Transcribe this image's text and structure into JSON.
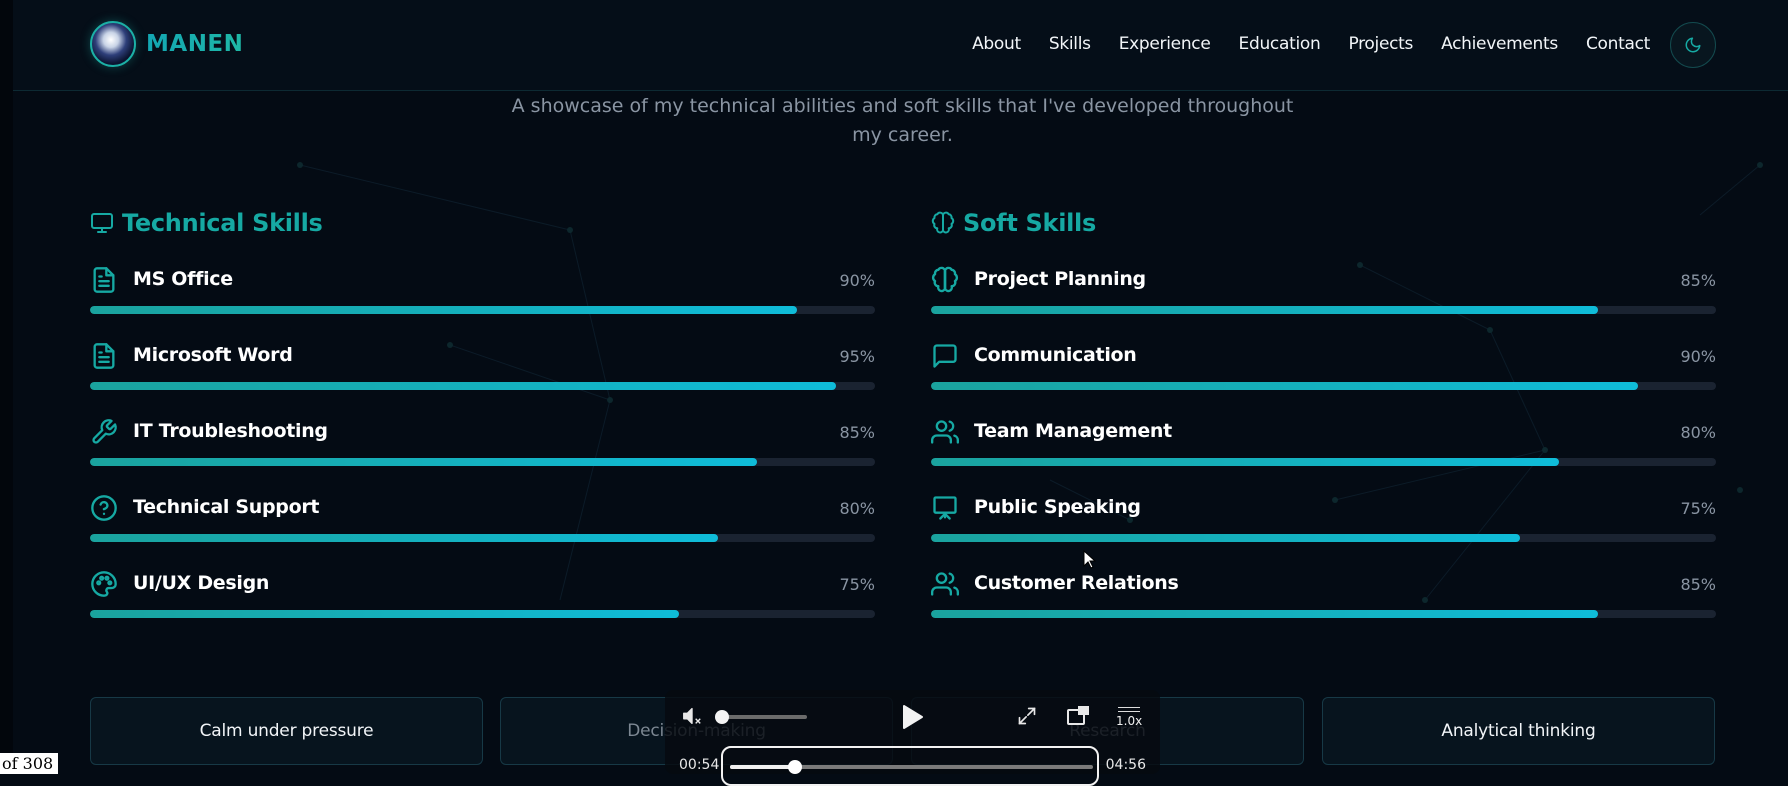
{
  "header": {
    "brand": "MANEN",
    "nav": [
      "About",
      "Skills",
      "Experience",
      "Education",
      "Projects",
      "Achievements",
      "Contact"
    ]
  },
  "intro": {
    "subtitle": "A showcase of my technical abilities and soft skills that I've developed throughout my career."
  },
  "technical": {
    "title": "Technical Skills",
    "icon": "monitor-icon",
    "skills": [
      {
        "name": "MS Office",
        "percent": 90,
        "icon": "file-text-icon"
      },
      {
        "name": "Microsoft Word",
        "percent": 95,
        "icon": "file-text-icon"
      },
      {
        "name": "IT Troubleshooting",
        "percent": 85,
        "icon": "wrench-icon"
      },
      {
        "name": "Technical Support",
        "percent": 80,
        "icon": "help-circle-icon"
      },
      {
        "name": "UI/UX Design",
        "percent": 75,
        "icon": "palette-icon"
      }
    ]
  },
  "soft": {
    "title": "Soft Skills",
    "icon": "brain-icon",
    "skills": [
      {
        "name": "Project Planning",
        "percent": 85,
        "icon": "brain-icon"
      },
      {
        "name": "Communication",
        "percent": 90,
        "icon": "message-square-icon"
      },
      {
        "name": "Team Management",
        "percent": 80,
        "icon": "users-icon"
      },
      {
        "name": "Public Speaking",
        "percent": 75,
        "icon": "presentation-icon"
      },
      {
        "name": "Customer Relations",
        "percent": 85,
        "icon": "users-icon"
      }
    ]
  },
  "tags": [
    "Calm under pressure",
    "Decision-making",
    "Research",
    "Analytical thinking"
  ],
  "player": {
    "current_time": "00:54",
    "duration": "04:56",
    "progress": 0.18,
    "speed": "1.0x",
    "volume": 0
  },
  "page_indicator": "of 308",
  "colors": {
    "accent": "#16a9a3",
    "bar_start": "#1aa39e",
    "bar_end": "#0fbcd9",
    "background": "#040b14"
  }
}
